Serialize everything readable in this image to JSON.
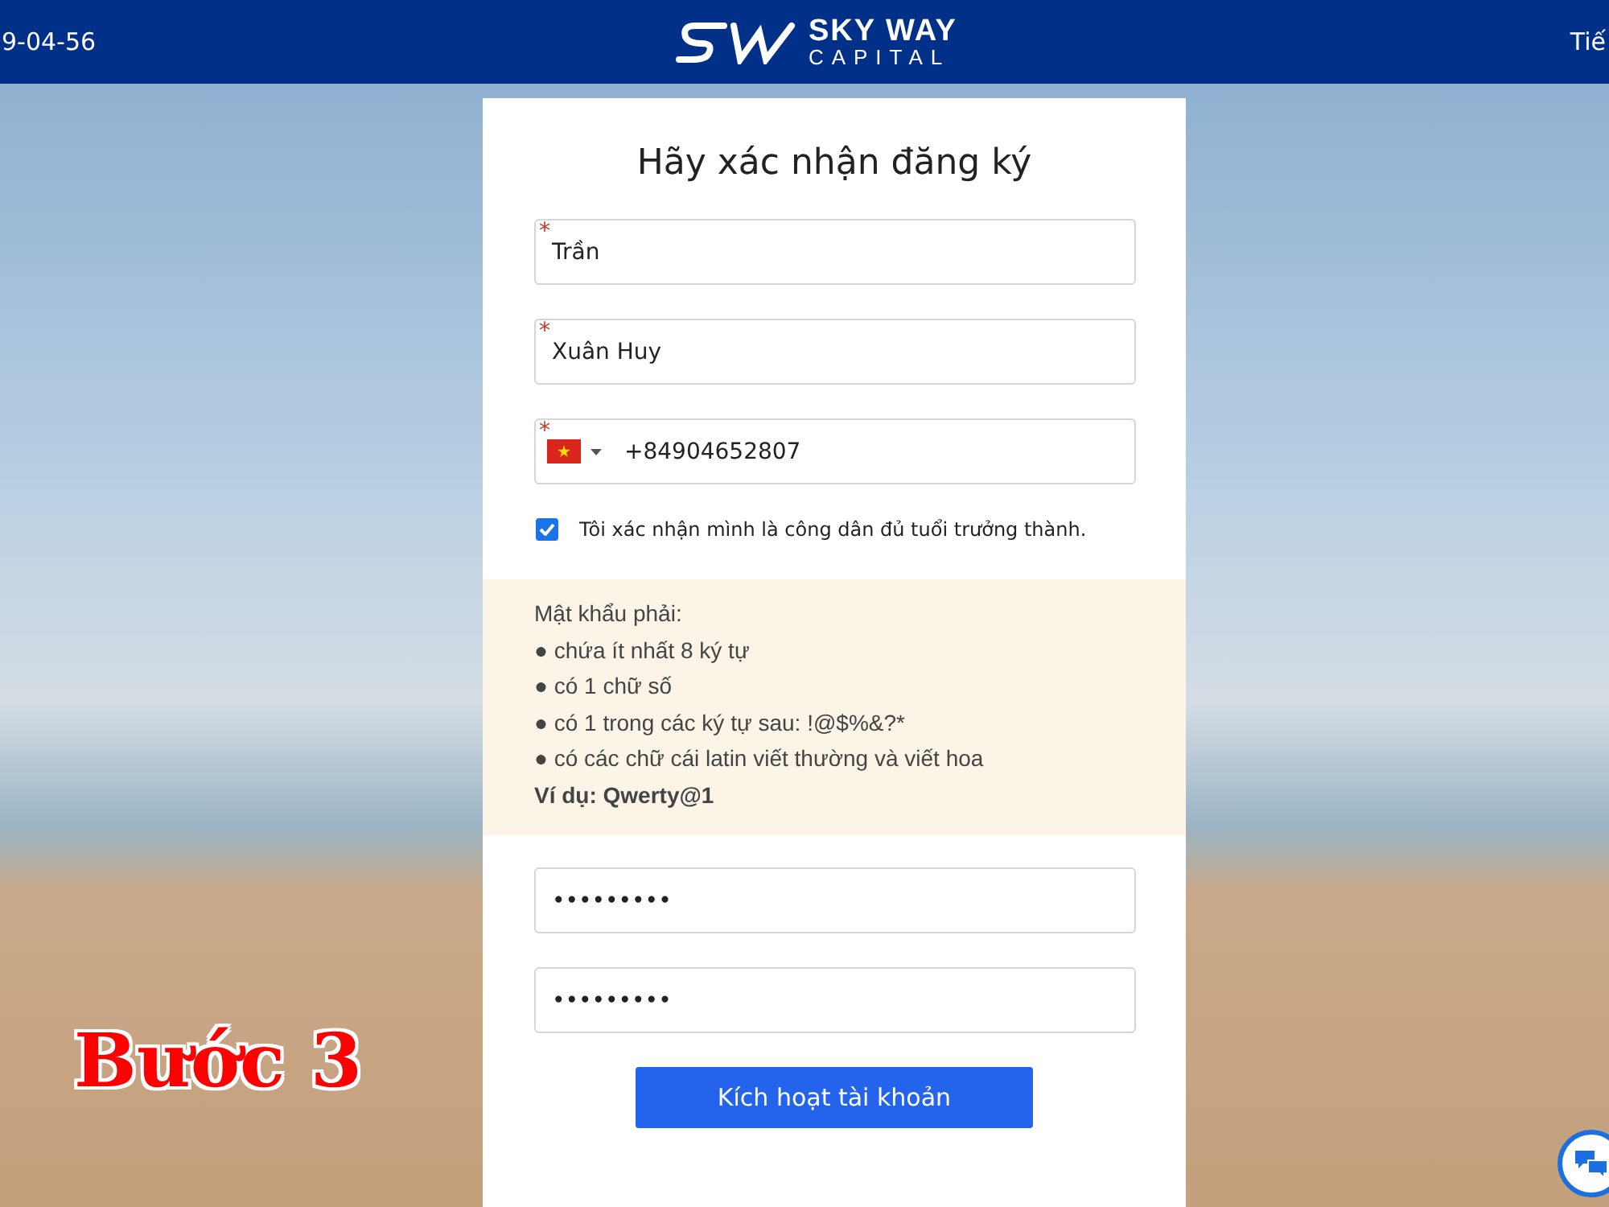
{
  "header": {
    "left_text": "9-04-56",
    "logo": {
      "line1": "SKY WAY",
      "line2": "CAPITAL"
    },
    "right_text": "Tiế"
  },
  "overlay_caption": "Bước 3",
  "form": {
    "title": "Hãy xác nhận đăng ký",
    "fields": [
      {
        "kind": "text",
        "required_mark": "*",
        "value": "Trần"
      },
      {
        "kind": "text",
        "required_mark": "*",
        "value": "Xuân Huy"
      },
      {
        "kind": "phone",
        "required_mark": "*",
        "value": "+84904652807"
      }
    ],
    "consent": {
      "checked": true,
      "label": "Tôi xác nhận mình là công dân đủ tuổi trưởng thành."
    },
    "password_rules": {
      "heading": "Mật khẩu phải:",
      "items": [
        "● chứa ít nhất 8 ký tự",
        "● có 1 chữ số",
        "● có 1 trong các ký tự sau: !@$%&?*",
        "● có các chữ cái latin viết thường và viết hoa"
      ],
      "example": "Ví dụ: Qwerty@1"
    },
    "password_fields": [
      {
        "value": "•••••••••"
      },
      {
        "value": "•••••••••"
      }
    ],
    "submit": "Kích hoạt tài khoản"
  }
}
